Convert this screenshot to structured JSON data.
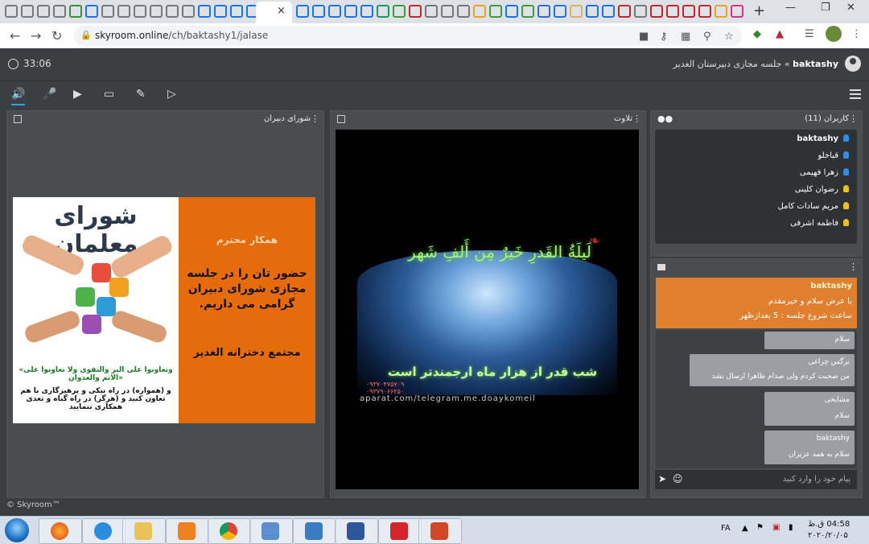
{
  "browser": {
    "url_host": "skyroom.online",
    "url_path": "/ch/baktashy1/jalase",
    "tab_close": "×",
    "new_tab": "+"
  },
  "app": {
    "timer": "33:06",
    "room_user": "baktashy",
    "room_sep": "»",
    "room_name": "جلسه مجازی دبیرستان الغدیر",
    "copyright": "© Skyroom™"
  },
  "panels": {
    "slide_title": "شورای دبیران",
    "video_title": "تلاوت",
    "users_title": "کاربران (11)",
    "chat_input_placeholder": "پیام خود را وارد کنید"
  },
  "slide": {
    "logo": "شورای معلمان",
    "greeting": "همکار محترم",
    "body": "حضور تان را در جلسه مجازی شورای دبیران گرامی می داریم.",
    "signature": "مجتمع دخترانه الغدیر",
    "verse": "«وتعاونوا علی البر والتقوی ولا تعاونوا علی الاثم والعدوان»",
    "translation": "و (همواره) در راه نیکی و پرهیزگاری با هم تعاون کنید و (هرگز) در راه گناه و تعدی همکاری ننمایید"
  },
  "video": {
    "arabic": "لَیلَةُ القَدرِ خَیرٌ مِن أَلفِ شَهر",
    "persian": "شب قدر از هزار ماه ارجمندتر است",
    "phone1": "۰۹۳۷۰۴۷۵۷۰۹",
    "phone2": "۰۹۳۷۹۰۶۶۲۵۰",
    "site": "aparat.com/telegram.me.doaykomeil"
  },
  "users": [
    {
      "name": "baktashy",
      "color": "#2f8fe8",
      "bold": true
    },
    {
      "name": "قباخلو",
      "color": "#2f8fe8",
      "bold": false
    },
    {
      "name": "زهرا فهیمی",
      "color": "#2f8fe8",
      "bold": false
    },
    {
      "name": "رضوان کلینی",
      "color": "#f0c020",
      "bold": false
    },
    {
      "name": "مریم سادات کامل",
      "color": "#f0c020",
      "bold": false
    },
    {
      "name": "فاطمه اشرفی",
      "color": "#f0c020",
      "bold": false
    }
  ],
  "chat": {
    "pinned": {
      "name": "baktashy",
      "line1": "با عرض سلام و خیرمقدم",
      "line2": "ساعت شروع جلسه : 5 بعدازظهر"
    },
    "messages": [
      {
        "name": "",
        "text": "سلام"
      },
      {
        "name": "نرگس چراغی",
        "text": "من صحبت کردم ولی صدام ظاهرا ارسال نشد"
      },
      {
        "name": "مشایخی",
        "text": "سلام"
      },
      {
        "name": "baktashy",
        "text": "سلام به همه عزیزان"
      }
    ]
  },
  "taskbar": {
    "lang": "FA",
    "time": "04:58 ق.ظ",
    "date": "۲۰۲۰/۲۰/۰۵"
  },
  "colors": {
    "accent": "#2aa4f4",
    "slide_orange": "#e56b0b",
    "pinned_orange": "#e0802f",
    "panel_bg": "#4a4d50"
  }
}
